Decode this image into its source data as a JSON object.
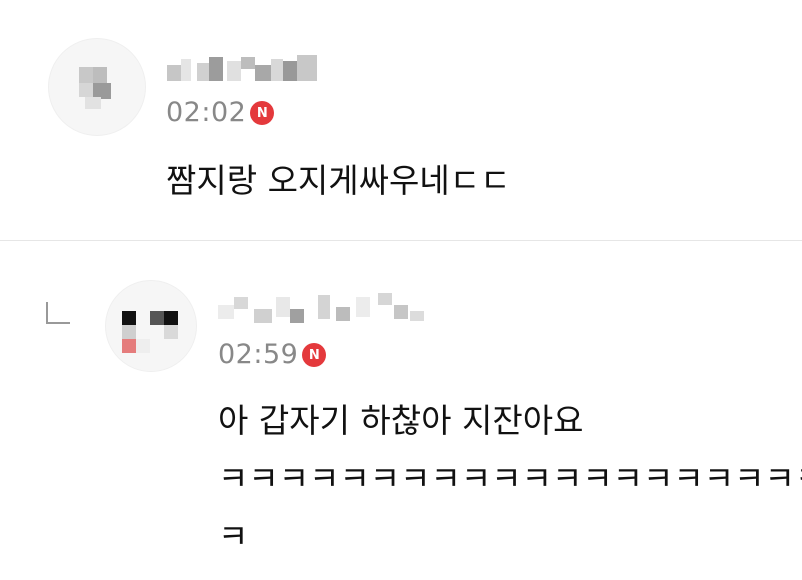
{
  "comments": [
    {
      "time": "02:02",
      "badge": "N",
      "text": "짬지랑 오지게싸우네ㄷㄷ"
    },
    {
      "time": "02:59",
      "badge": "N",
      "text_line1": "아 갑자기 하찮아 지잔아요",
      "text_line2": "ㅋㅋㅋㅋㅋㅋㅋㅋㅋㅋㅋㅋㅋㅋㅋㅋㅋㅋㅋㅋㅋㅋ",
      "text_line3": "ㅋ"
    }
  ]
}
